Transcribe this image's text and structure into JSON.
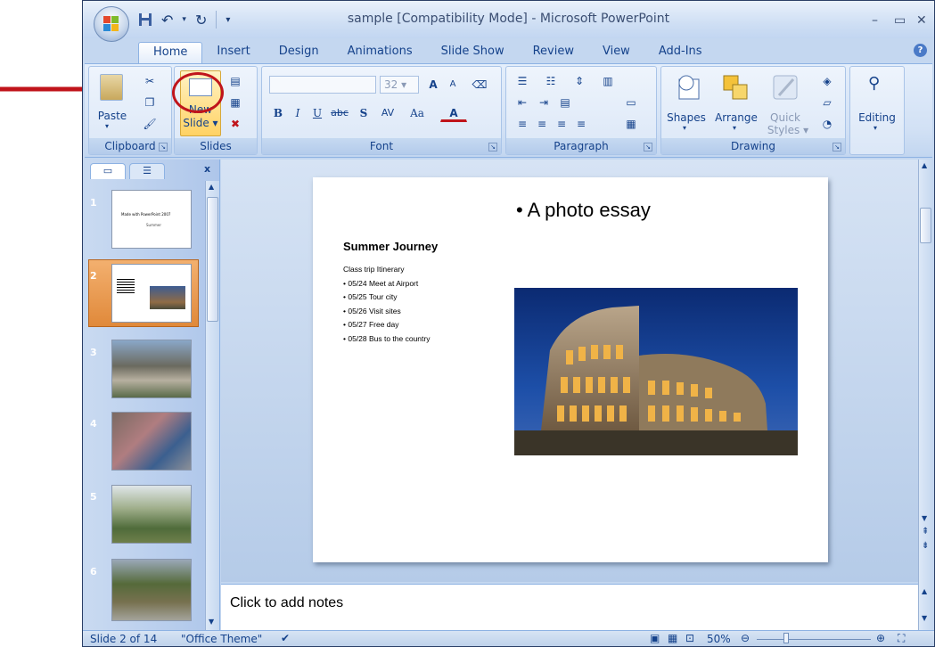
{
  "window": {
    "title": "sample [Compatibility Mode] - Microsoft PowerPoint"
  },
  "tabs": [
    "Home",
    "Insert",
    "Design",
    "Animations",
    "Slide Show",
    "Review",
    "View",
    "Add-Ins"
  ],
  "ribbon": {
    "clipboard": {
      "label": "Clipboard",
      "paste": "Paste"
    },
    "slides": {
      "label": "Slides",
      "new_slide_line1": "New",
      "new_slide_line2": "Slide"
    },
    "font": {
      "label": "Font",
      "size": "32",
      "grow": "A",
      "shrink": "A",
      "bold": "B",
      "italic": "I",
      "underline": "U",
      "strike": "abc",
      "shadow": "S",
      "spacing": "AV",
      "case": "Aa",
      "color": "A"
    },
    "paragraph": {
      "label": "Paragraph"
    },
    "drawing": {
      "label": "Drawing",
      "shapes": "Shapes",
      "arrange": "Arrange",
      "quick_styles_1": "Quick",
      "quick_styles_2": "Styles"
    },
    "editing": {
      "label": "Editing"
    }
  },
  "slide_pane": {
    "close": "x",
    "slides": [
      "1",
      "2",
      "3",
      "4",
      "5",
      "6"
    ],
    "slide1_title": "Made with PowerPoint 2007",
    "slide1_sub": "Summer"
  },
  "slide": {
    "bullet": "A photo essay",
    "heading": "Summer Journey",
    "lines": [
      "Class trip Itinerary",
      "• 05/24 Meet at Airport",
      "• 05/25 Tour city",
      "• 05/26 Visit sites",
      "• 05/27 Free day",
      "• 05/28 Bus to the country"
    ]
  },
  "notes": {
    "placeholder": "Click to add notes"
  },
  "status": {
    "slide_of": "Slide 2 of 14",
    "theme": "\"Office Theme\"",
    "zoom": "50%"
  },
  "colors": {
    "arrow": "#c0141b",
    "highlight_circle": "#c0141b",
    "selected_thumb": "#e8963f"
  }
}
